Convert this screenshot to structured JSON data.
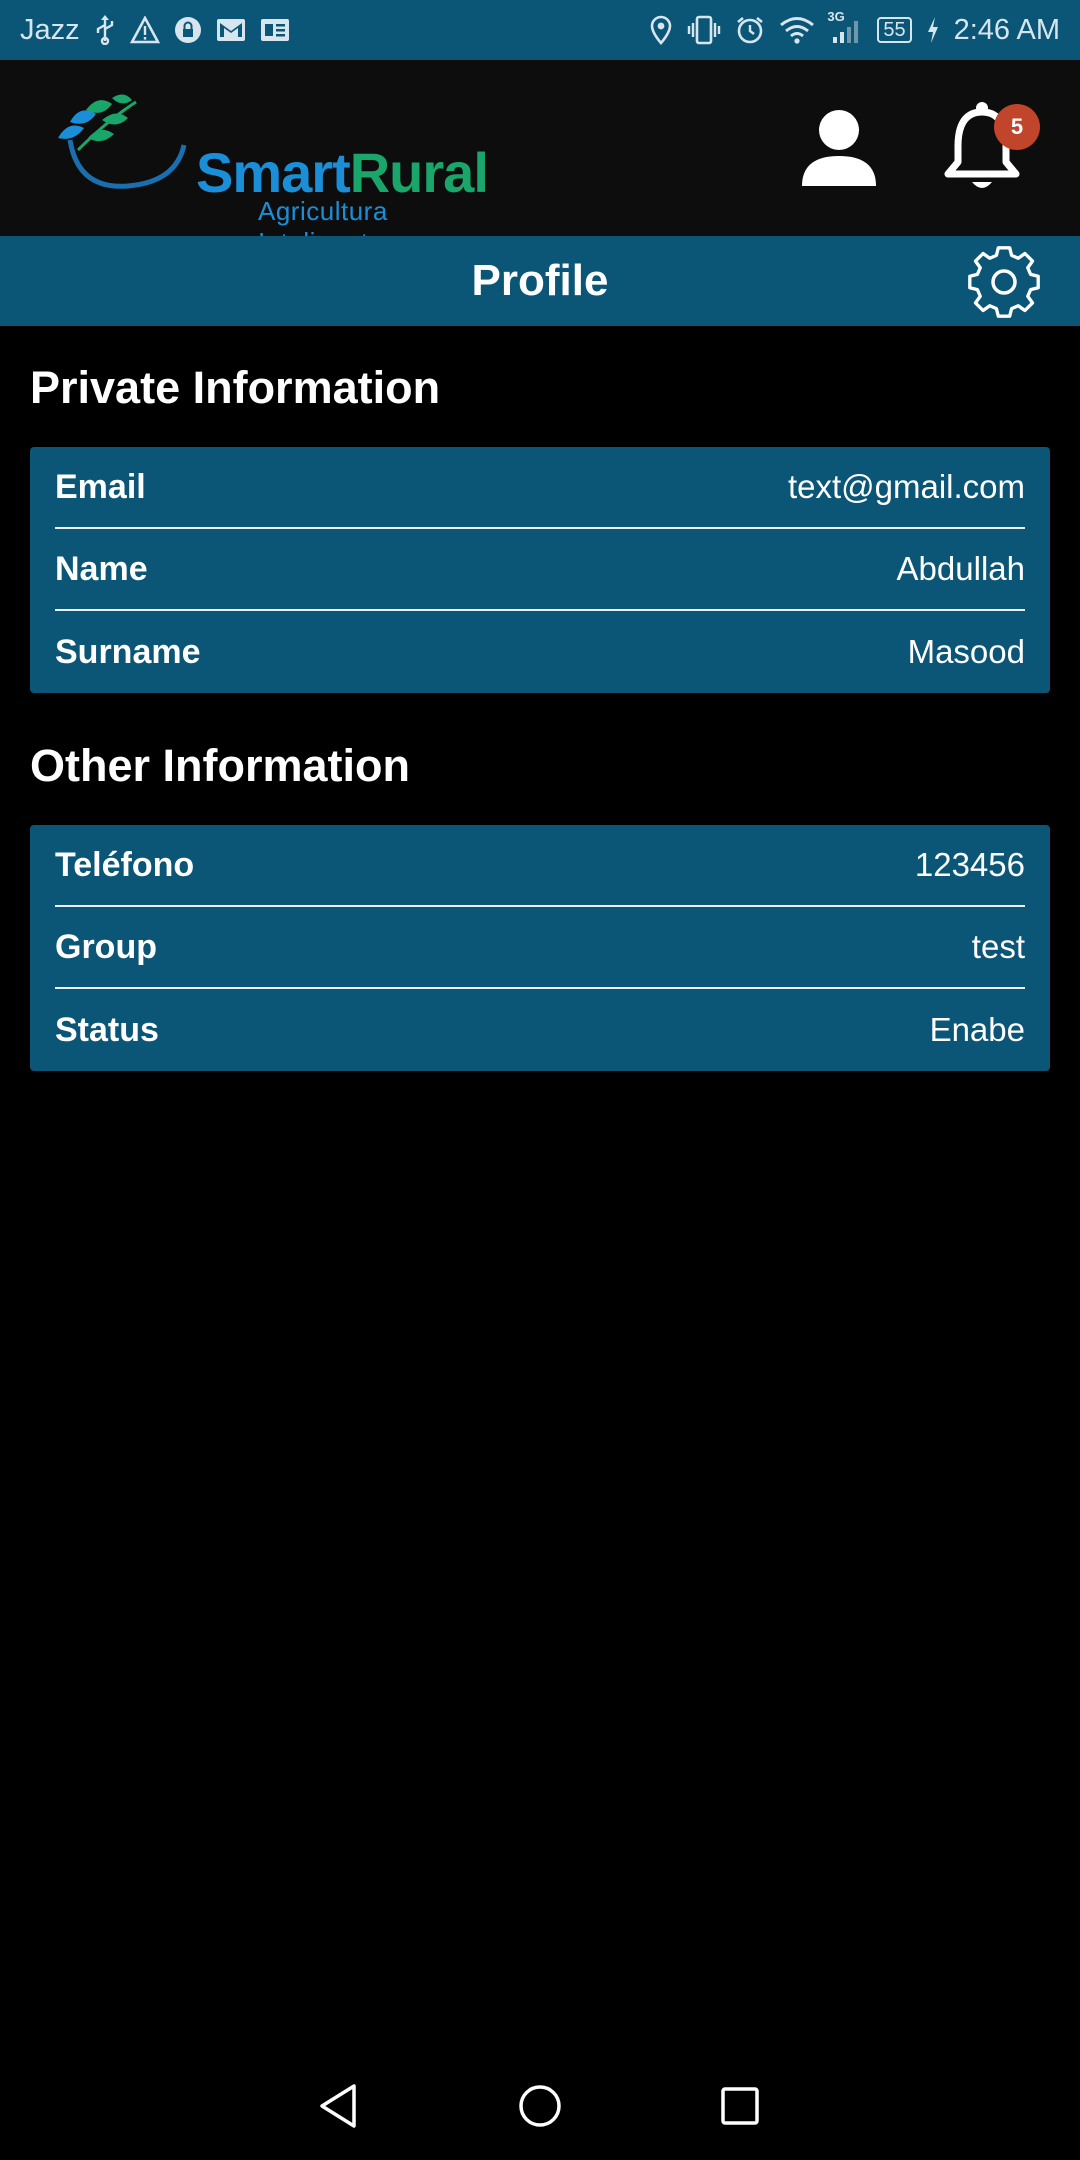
{
  "status_bar": {
    "carrier": "Jazz",
    "network": "3G",
    "battery": "55",
    "time": "2:46 AM"
  },
  "header": {
    "logo": {
      "brand_part1": "Smart",
      "brand_part2": "Rural",
      "tagline": "Agricultura Inteligente"
    },
    "notification_count": "5"
  },
  "title_bar": {
    "title": "Profile"
  },
  "private_info": {
    "heading": "Private Information",
    "rows": [
      {
        "label": "Email",
        "value": "text@gmail.com"
      },
      {
        "label": "Name",
        "value": "Abdullah"
      },
      {
        "label": "Surname",
        "value": "Masood"
      }
    ]
  },
  "other_info": {
    "heading": "Other Information",
    "rows": [
      {
        "label": "Teléfono",
        "value": "123456"
      },
      {
        "label": "Group",
        "value": "test"
      },
      {
        "label": "Status",
        "value": "Enabe"
      }
    ]
  },
  "icons": {
    "user": "user-icon",
    "bell": "bell-icon",
    "settings": "gear-icon",
    "nav_back": "back-triangle-icon",
    "nav_home": "home-circle-icon",
    "nav_recents": "recents-square-icon"
  },
  "colors": {
    "primary": "#0b5677",
    "header_bg": "#0d0d0d",
    "background": "#000000",
    "badge": "#c0452a",
    "brand_blue": "#1a8fd8",
    "brand_green": "#1aa56a"
  }
}
